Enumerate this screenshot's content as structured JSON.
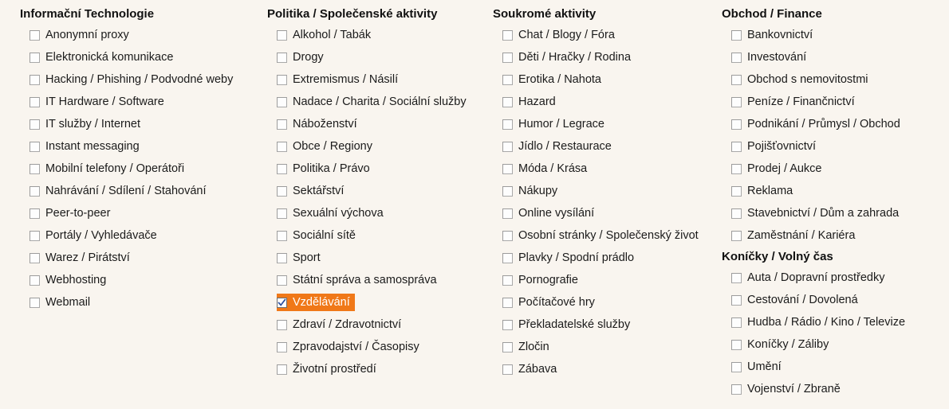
{
  "theme": {
    "background": "#f9f5ef",
    "text": "#1b1b1b",
    "heading": "#111111",
    "selection_background": "#f07818",
    "selection_text": "#ffffff",
    "checkbox_border": "#a9a9a9",
    "checkmark": "#2a4fa0"
  },
  "columns": [
    {
      "groups": [
        {
          "title": "Informační Technologie",
          "items": [
            {
              "label": "Anonymní proxy",
              "checked": false
            },
            {
              "label": "Elektronická komunikace",
              "checked": false
            },
            {
              "label": "Hacking / Phishing / Podvodné weby",
              "checked": false
            },
            {
              "label": "IT Hardware / Software",
              "checked": false
            },
            {
              "label": "IT služby / Internet",
              "checked": false
            },
            {
              "label": "Instant messaging",
              "checked": false
            },
            {
              "label": "Mobilní telefony / Operátoři",
              "checked": false
            },
            {
              "label": "Nahrávání / Sdílení / Stahování",
              "checked": false
            },
            {
              "label": "Peer-to-peer",
              "checked": false
            },
            {
              "label": "Portály / Vyhledávače",
              "checked": false
            },
            {
              "label": "Warez / Pirátství",
              "checked": false
            },
            {
              "label": "Webhosting",
              "checked": false
            },
            {
              "label": "Webmail",
              "checked": false
            }
          ]
        }
      ]
    },
    {
      "groups": [
        {
          "title": "Politika / Společenské aktivity",
          "items": [
            {
              "label": "Alkohol / Tabák",
              "checked": false
            },
            {
              "label": "Drogy",
              "checked": false
            },
            {
              "label": "Extremismus / Násilí",
              "checked": false
            },
            {
              "label": "Nadace / Charita / Sociální služby",
              "checked": false
            },
            {
              "label": "Náboženství",
              "checked": false
            },
            {
              "label": "Obce / Regiony",
              "checked": false
            },
            {
              "label": "Politika / Právo",
              "checked": false
            },
            {
              "label": "Sektářství",
              "checked": false
            },
            {
              "label": "Sexuální výchova",
              "checked": false
            },
            {
              "label": "Sociální sítě",
              "checked": false
            },
            {
              "label": "Sport",
              "checked": false
            },
            {
              "label": "Státní správa a samospráva",
              "checked": false
            },
            {
              "label": "Vzdělávání",
              "checked": true
            },
            {
              "label": "Zdraví / Zdravotnictví",
              "checked": false
            },
            {
              "label": "Zpravodajství / Časopisy",
              "checked": false
            },
            {
              "label": "Životní prostředí",
              "checked": false
            }
          ]
        }
      ]
    },
    {
      "groups": [
        {
          "title": "Soukromé aktivity",
          "items": [
            {
              "label": "Chat / Blogy / Fóra",
              "checked": false
            },
            {
              "label": "Děti / Hračky / Rodina",
              "checked": false
            },
            {
              "label": "Erotika / Nahota",
              "checked": false
            },
            {
              "label": "Hazard",
              "checked": false
            },
            {
              "label": "Humor / Legrace",
              "checked": false
            },
            {
              "label": "Jídlo / Restaurace",
              "checked": false
            },
            {
              "label": "Móda / Krása",
              "checked": false
            },
            {
              "label": "Nákupy",
              "checked": false
            },
            {
              "label": "Online vysílání",
              "checked": false
            },
            {
              "label": "Osobní stránky / Společenský život",
              "checked": false
            },
            {
              "label": "Plavky / Spodní prádlo",
              "checked": false
            },
            {
              "label": "Pornografie",
              "checked": false
            },
            {
              "label": "Počítačové hry",
              "checked": false
            },
            {
              "label": "Překladatelské služby",
              "checked": false
            },
            {
              "label": "Zločin",
              "checked": false
            },
            {
              "label": "Zábava",
              "checked": false
            }
          ]
        }
      ]
    },
    {
      "groups": [
        {
          "title": "Obchod / Finance",
          "items": [
            {
              "label": "Bankovnictví",
              "checked": false
            },
            {
              "label": "Investování",
              "checked": false
            },
            {
              "label": "Obchod s nemovitostmi",
              "checked": false
            },
            {
              "label": "Peníze / Finančnictví",
              "checked": false
            },
            {
              "label": "Podnikání / Průmysl / Obchod",
              "checked": false
            },
            {
              "label": "Pojišťovnictví",
              "checked": false
            },
            {
              "label": "Prodej / Aukce",
              "checked": false
            },
            {
              "label": "Reklama",
              "checked": false
            },
            {
              "label": "Stavebnictví / Dům a zahrada",
              "checked": false
            },
            {
              "label": "Zaměstnání / Kariéra",
              "checked": false
            }
          ]
        },
        {
          "title": "Koníčky / Volný čas",
          "items": [
            {
              "label": "Auta / Dopravní prostředky",
              "checked": false
            },
            {
              "label": "Cestování / Dovolená",
              "checked": false
            },
            {
              "label": "Hudba / Rádio / Kino / Televize",
              "checked": false
            },
            {
              "label": "Koníčky / Záliby",
              "checked": false
            },
            {
              "label": "Umění",
              "checked": false
            },
            {
              "label": "Vojenství / Zbraně",
              "checked": false
            }
          ]
        }
      ]
    }
  ]
}
